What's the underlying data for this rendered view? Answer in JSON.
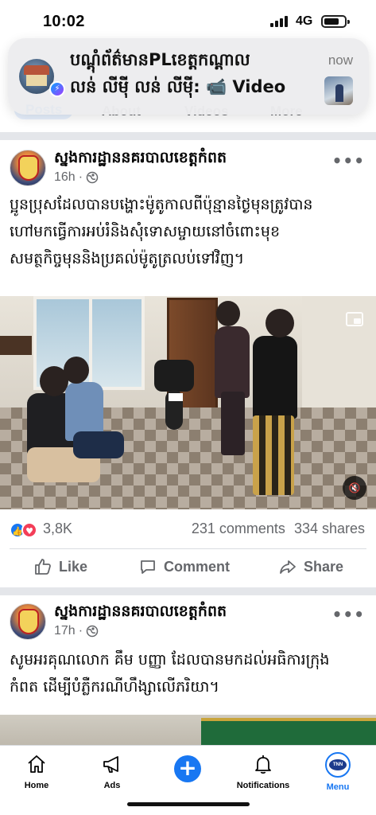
{
  "status_bar": {
    "time": "10:02",
    "network": "4G"
  },
  "top_tabs": [
    "Posts",
    "About",
    "Videos",
    "More"
  ],
  "notification": {
    "title": "បណ្ដុំព័ត៌មានPLខេត្តកណ្ដាល",
    "body": "លន់ លីម៉ី លន់ លីម៉ី: 📹 Video",
    "time": "now"
  },
  "posts": [
    {
      "page_name": "ស្នងការដ្ឋាននគរបាលខេត្តកំពត",
      "time": "16h",
      "text_lines": [
        "ប្អូនប្រុសដែលបានបង្ហោះម៉ូតូកាលពីប៉ុន្មានថ្ងៃមុនត្រូវបាន",
        "ហៅមកធ្វើការអប់រំនិងសុំទោសម្ចាយនៅចំពោះមុខ",
        "សមត្ថកិច្ចមុននិងប្រគល់ម៉ូតូត្រលប់ទៅវិញ។"
      ],
      "reaction_count": "3,8K",
      "comments": "231 comments",
      "shares": "334 shares"
    },
    {
      "page_name": "ស្នងការដ្ឋាននគរបាលខេត្តកំពត",
      "time": "17h",
      "text_lines": [
        "សូមអរគុណលោក គឹម បញ្ញា ដែលបានមកដល់អធិការក្រុង",
        "កំពត ដើម្បីបំភ្លឺករណីហឹង្សាលើភរិយា។"
      ]
    }
  ],
  "actions": {
    "like": "Like",
    "comment": "Comment",
    "share": "Share"
  },
  "bottom_nav": [
    {
      "label": "Home",
      "icon": "home-icon"
    },
    {
      "label": "Ads",
      "icon": "megaphone-icon"
    },
    {
      "label": "",
      "icon": "plus-icon"
    },
    {
      "label": "Notifications",
      "icon": "bell-icon"
    },
    {
      "label": "Menu",
      "icon": "profile-avatar-icon"
    }
  ],
  "menu_logo_text": "TNN",
  "colors": {
    "brand_blue": "#1877f2",
    "love_red": "#f33e58",
    "muted": "#65676b"
  }
}
